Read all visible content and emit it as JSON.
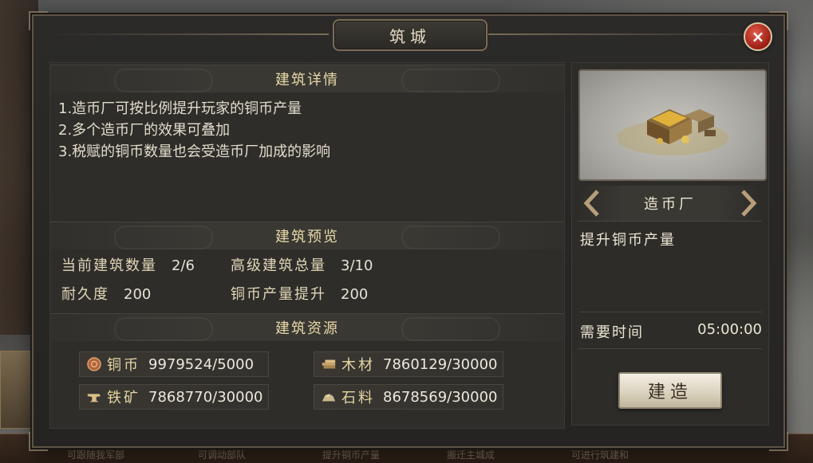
{
  "dialog": {
    "title": "筑城",
    "close_label": "×"
  },
  "details": {
    "header": "建筑详情",
    "lines": [
      "1.造币厂可按比例提升玩家的铜币产量",
      "2.多个造币厂的效果可叠加",
      "3.税赋的铜币数量也会受造币厂加成的影响"
    ]
  },
  "preview_section": {
    "header": "建筑预览",
    "stats": [
      {
        "label": "当前建筑数量",
        "value": "2/6"
      },
      {
        "label": "高级建筑总量",
        "value": "3/10"
      },
      {
        "label": "耐久度",
        "value": "200"
      },
      {
        "label": "铜币产量提升",
        "value": "200"
      }
    ]
  },
  "resources": {
    "header": "建筑资源",
    "items": [
      {
        "name": "铜币",
        "value": "9979524/5000",
        "icon": "coin-icon"
      },
      {
        "name": "木材",
        "value": "7860129/30000",
        "icon": "wood-icon"
      },
      {
        "name": "铁矿",
        "value": "7868770/30000",
        "icon": "iron-icon"
      },
      {
        "name": "石料",
        "value": "8678569/30000",
        "icon": "stone-icon"
      }
    ]
  },
  "building": {
    "name": "造币厂",
    "description": "提升铜币产量",
    "time_label": "需要时间",
    "time_value": "05:00:00",
    "build_label": "建造"
  },
  "background": {
    "bottom_hints": [
      "可跟随我军部",
      "可调动部队",
      "提升铜币产量",
      "搬迁主城成",
      "可进行筑建和"
    ]
  },
  "colors": {
    "accent_gold": "#e8d9a8",
    "close_red": "#c0392b",
    "panel_bg": "#2e2d2a"
  }
}
